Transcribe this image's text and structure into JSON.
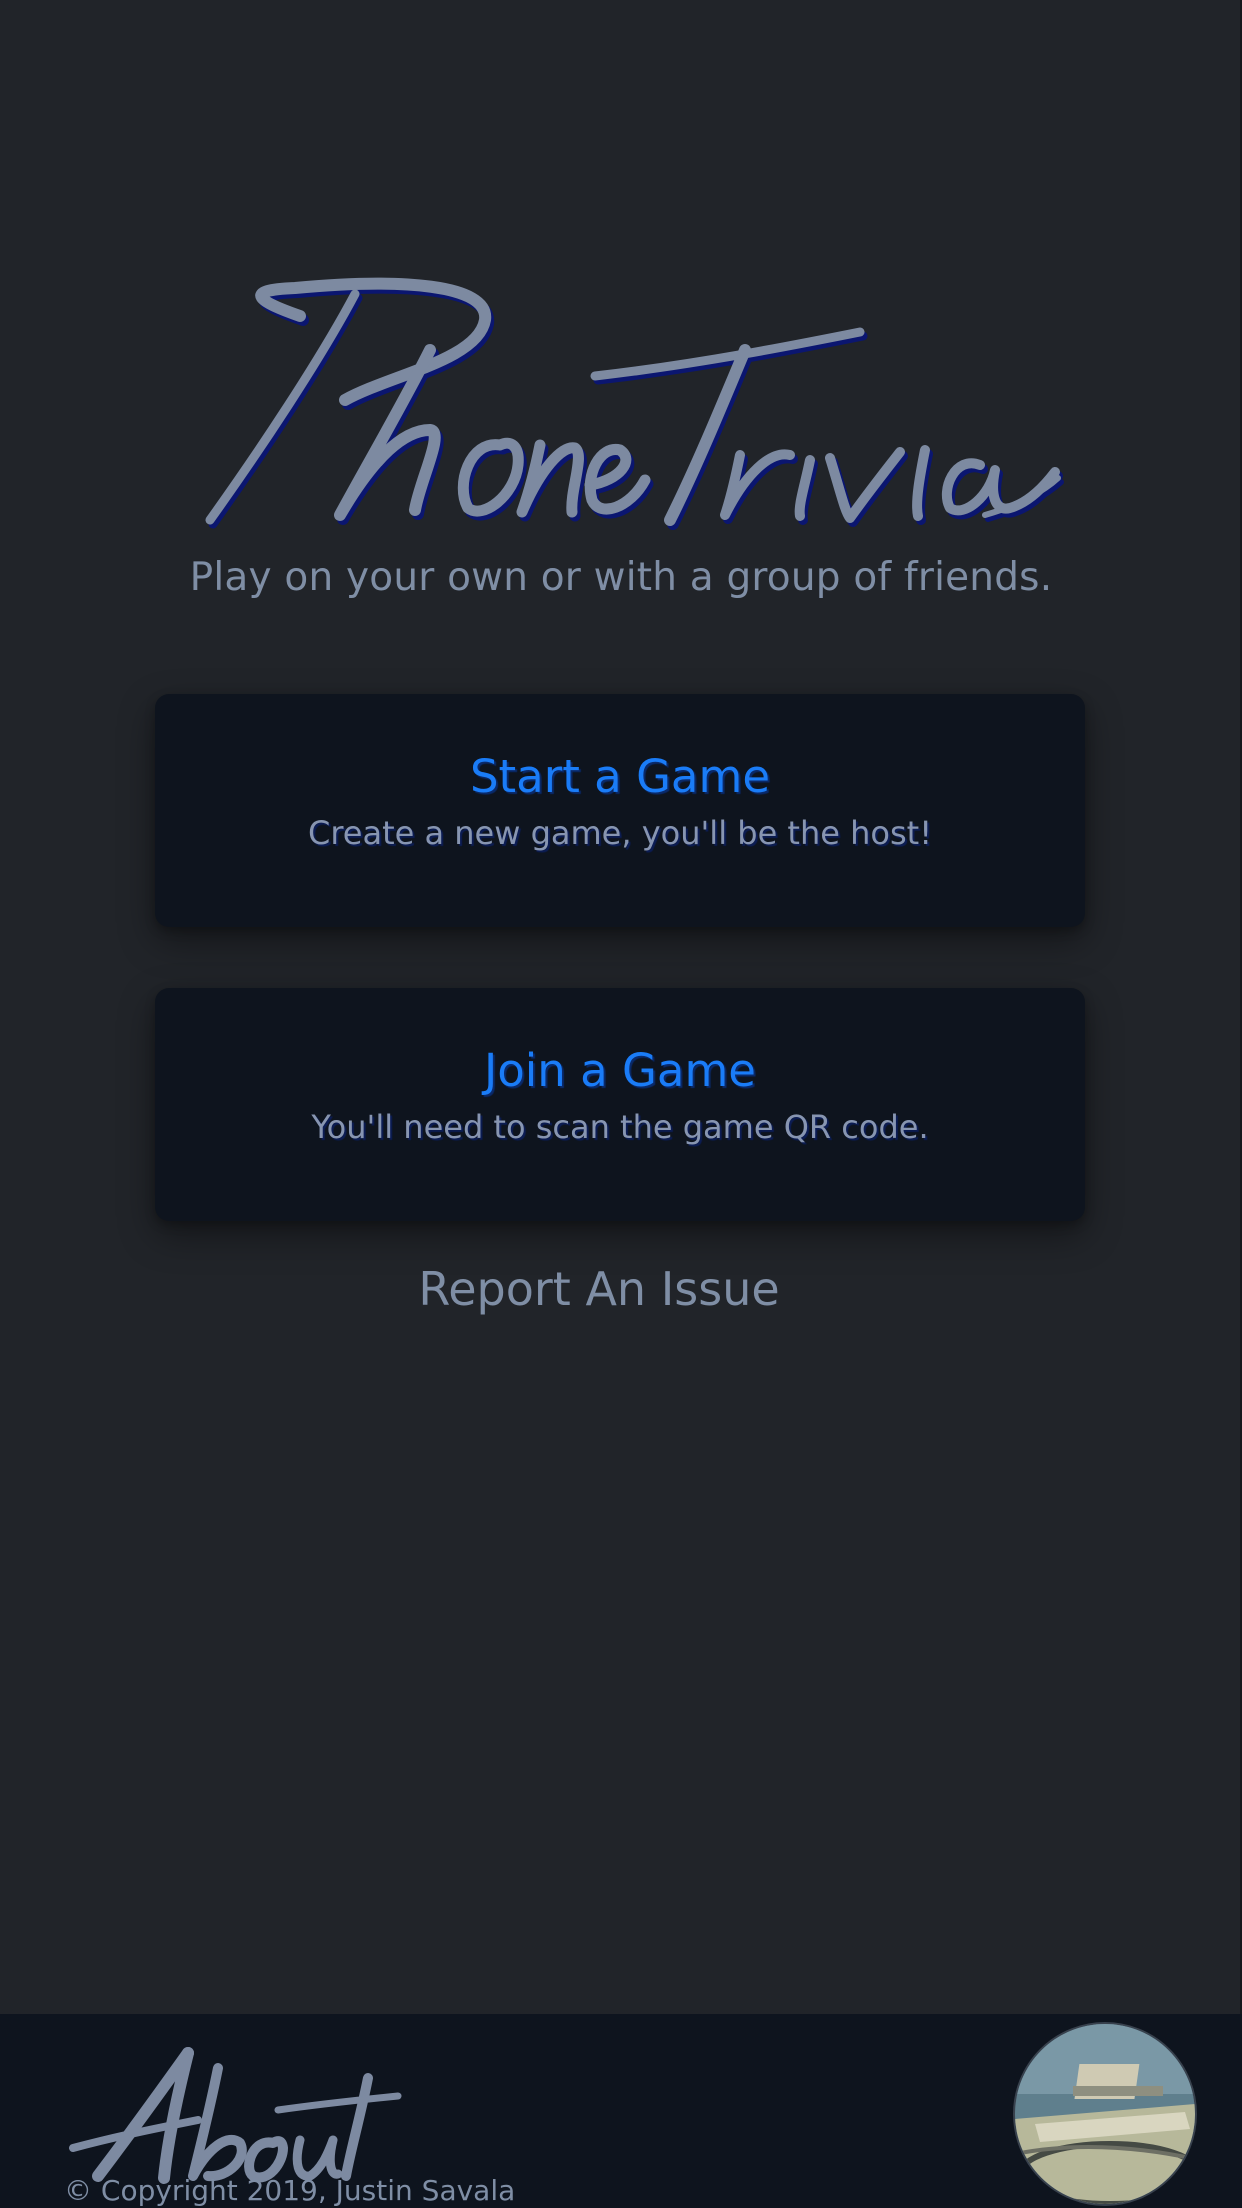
{
  "app": {
    "logo_text": "Phone Trivia",
    "tagline": "Play on your own or with a group of friends."
  },
  "actions": {
    "start": {
      "title": "Start a Game",
      "description": "Create a new game, you'll be the host!"
    },
    "join": {
      "title": "Join a Game",
      "description": "You'll need to scan the game QR code."
    },
    "report_issue": "Report An Issue"
  },
  "footer": {
    "about_text": "About",
    "copyright": "© Copyright 2019, Justin Savala",
    "avatar_icon": "profile-photo"
  },
  "colors": {
    "background": "#212429",
    "card": "#0e141e",
    "accent": "#1a7cf7",
    "muted_text": "#7f8ea5",
    "logo_fill": "#7d8aa1"
  }
}
